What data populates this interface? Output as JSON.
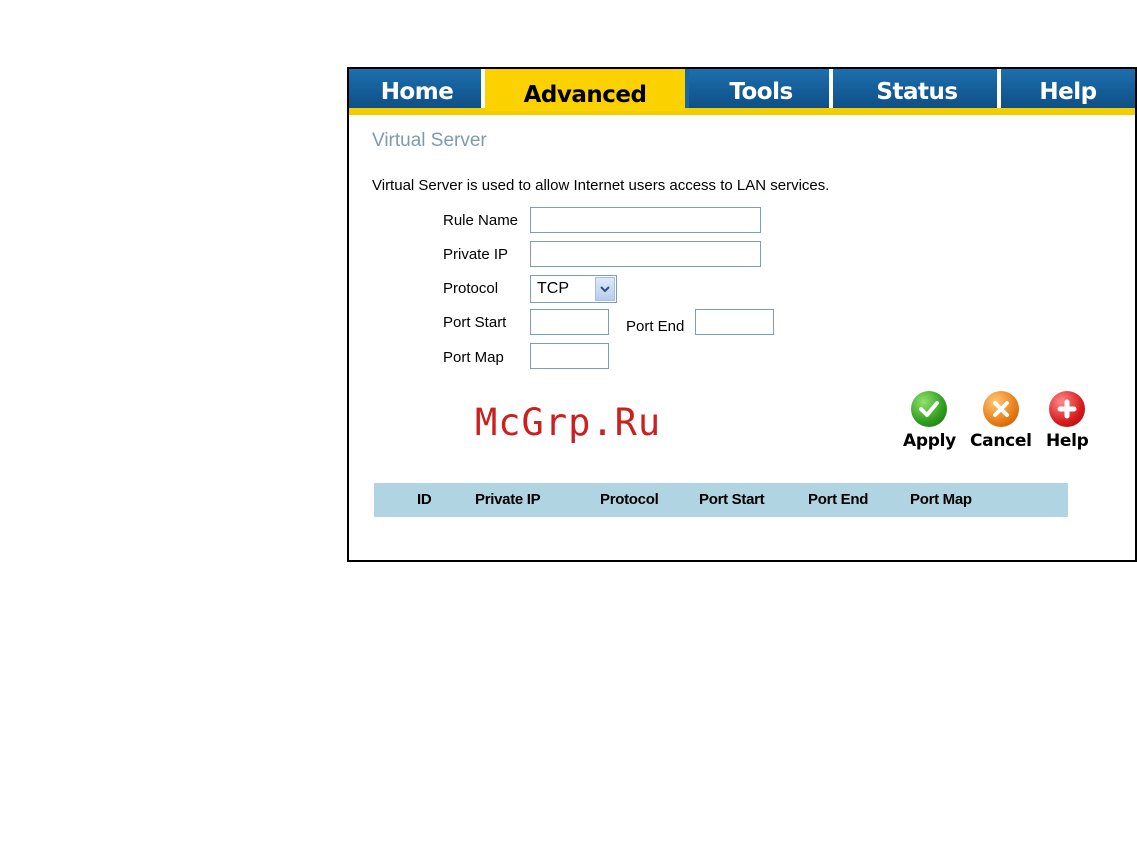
{
  "nav": {
    "tabs": [
      {
        "label": "Home",
        "active": false
      },
      {
        "label": "Advanced",
        "active": true
      },
      {
        "label": "Tools",
        "active": false
      },
      {
        "label": "Status",
        "active": false
      },
      {
        "label": "Help",
        "active": false
      }
    ]
  },
  "page": {
    "title": "Virtual Server",
    "description": "Virtual Server is used to allow Internet users access to LAN services."
  },
  "form": {
    "rule_name_label": "Rule Name",
    "rule_name_value": "",
    "private_ip_label": "Private IP",
    "private_ip_value": "",
    "protocol_label": "Protocol",
    "protocol_value": "TCP",
    "port_start_label": "Port Start",
    "port_start_value": "",
    "port_end_label": "Port End",
    "port_end_value": "",
    "port_map_label": "Port Map",
    "port_map_value": ""
  },
  "actions": {
    "apply_label": "Apply",
    "cancel_label": "Cancel",
    "help_label": "Help"
  },
  "watermark": "McGrp.Ru",
  "table": {
    "columns": [
      "ID",
      "Private IP",
      "Protocol",
      "Port Start",
      "Port End",
      "Port Map"
    ],
    "rows": []
  },
  "colors": {
    "nav_blue": "#1a66a2",
    "nav_yellow": "#fcd100",
    "title_gray": "#7f9aae",
    "table_header": "#b1d4e3",
    "apply_green": "#2e9c1e",
    "cancel_orange": "#e87b14",
    "help_red": "#d61b1b"
  }
}
